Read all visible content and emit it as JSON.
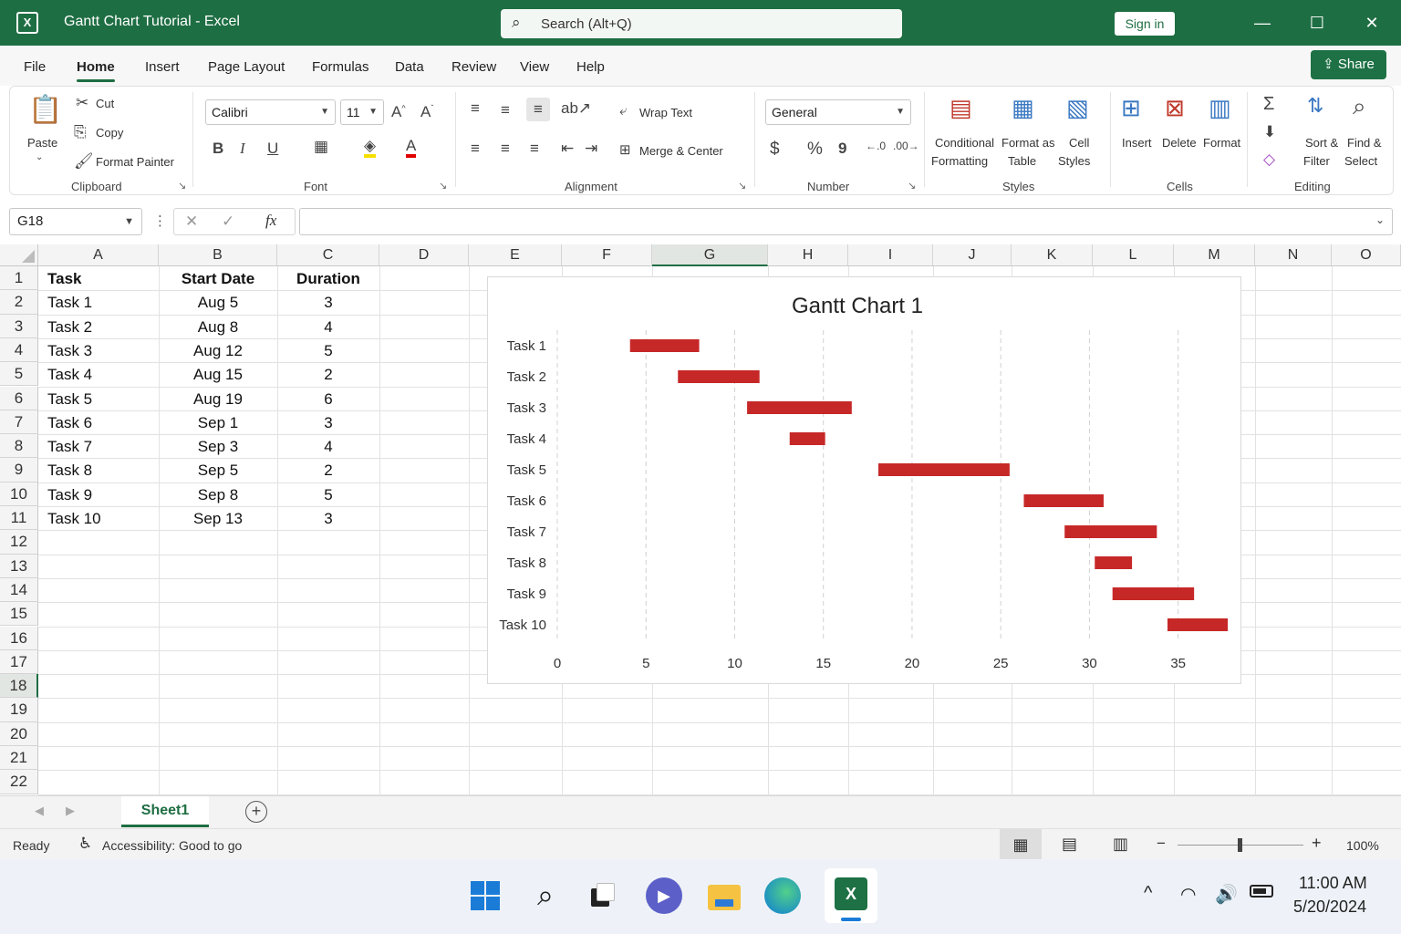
{
  "window": {
    "title": "Gantt Chart Tutorial  -  Excel",
    "app_icon": "X",
    "search_placeholder": "Search (Alt+Q)",
    "sign_in": "Sign in",
    "minimize": "—",
    "maximize": "☐",
    "close": "✕"
  },
  "menu": {
    "tabs": [
      "File",
      "Home",
      "Insert",
      "Page Layout",
      "Formulas",
      "Data",
      "Review",
      "View",
      "Help"
    ],
    "active": "Home",
    "share": "Share"
  },
  "ribbon": {
    "clipboard": {
      "label": "Clipboard",
      "paste": "Paste",
      "cut": "Cut",
      "copy": "Copy",
      "format_painter": "Format Painter"
    },
    "font": {
      "label": "Font",
      "font_name": "Calibri",
      "font_size": "11",
      "bold": "B",
      "italic": "I",
      "underline": "U"
    },
    "alignment": {
      "label": "Alignment",
      "wrap_text": "Wrap Text",
      "merge_center": "Merge & Center"
    },
    "number": {
      "label": "Number",
      "format": "General",
      "currency": "$",
      "percent": "%",
      "comma": "9"
    },
    "styles": {
      "label": "Styles",
      "conditional_1": "Conditional",
      "conditional_2": "Formatting",
      "format_table_1": "Format as",
      "format_table_2": "Table",
      "cell_styles_1": "Cell",
      "cell_styles_2": "Styles"
    },
    "cells": {
      "label": "Cells",
      "insert": "Insert",
      "delete": "Delete",
      "format": "Format"
    },
    "editing": {
      "label": "Editing",
      "sort_1": "Sort &",
      "sort_2": "Filter",
      "find_1": "Find &",
      "find_2": "Select"
    }
  },
  "formula_bar": {
    "name_box": "G18",
    "fx": "fx",
    "value": ""
  },
  "columns": [
    "A",
    "B",
    "C",
    "D",
    "E",
    "F",
    "G",
    "H",
    "I",
    "J",
    "K",
    "L",
    "M",
    "N",
    "O"
  ],
  "selected_column": "G",
  "rows": [
    "1",
    "2",
    "3",
    "4",
    "5",
    "6",
    "7",
    "8",
    "9",
    "10",
    "11",
    "12",
    "13",
    "14",
    "15",
    "16",
    "17",
    "18",
    "19",
    "20",
    "21",
    "22"
  ],
  "selected_row": "18",
  "table": {
    "headers": [
      "Task",
      "Start Date",
      "Duration"
    ],
    "rows": [
      [
        "Task 1",
        "Aug 5",
        "3"
      ],
      [
        "Task 2",
        "Aug 8",
        "4"
      ],
      [
        "Task 3",
        "Aug 12",
        "5"
      ],
      [
        "Task 4",
        "Aug 15",
        "2"
      ],
      [
        "Task 5",
        "Aug 19",
        "6"
      ],
      [
        "Task 6",
        "Sep 1",
        "3"
      ],
      [
        "Task 7",
        "Sep 3",
        "4"
      ],
      [
        "Task 8",
        "Sep 5",
        "2"
      ],
      [
        "Task 9",
        "Sep 8",
        "5"
      ],
      [
        "Task 10",
        "Sep 13",
        "3"
      ]
    ]
  },
  "chart": {
    "title": "Gantt Chart 1",
    "bar_color": "#c62828",
    "x_ticks": [
      "0",
      "5",
      "10",
      "15",
      "20",
      "25",
      "30",
      "35"
    ],
    "x_range": [
      0,
      38
    ],
    "tasks": [
      {
        "name": "Task 1",
        "start": 4.1,
        "end": 8.0
      },
      {
        "name": "Task 2",
        "start": 6.8,
        "end": 11.4
      },
      {
        "name": "Task 3",
        "start": 10.7,
        "end": 16.6
      },
      {
        "name": "Task 4",
        "start": 13.1,
        "end": 15.1
      },
      {
        "name": "Task 5",
        "start": 18.1,
        "end": 25.5
      },
      {
        "name": "Task 6",
        "start": 26.3,
        "end": 30.8
      },
      {
        "name": "Task 7",
        "start": 28.6,
        "end": 33.8
      },
      {
        "name": "Task 8",
        "start": 30.3,
        "end": 32.4
      },
      {
        "name": "Task 9",
        "start": 31.3,
        "end": 35.9
      },
      {
        "name": "Task 10",
        "start": 34.4,
        "end": 37.8
      }
    ]
  },
  "sheet_tab": "Sheet1",
  "status": {
    "ready": "Ready",
    "accessibility": "Accessibility: Good to go",
    "zoom": "100%"
  },
  "taskbar": {
    "time": "11:00 AM",
    "date": "5/20/2024"
  }
}
